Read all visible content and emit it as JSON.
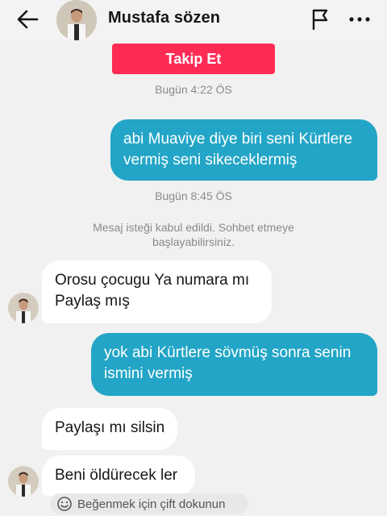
{
  "header": {
    "contact_name": "Mustafa sözen",
    "icons": {
      "back": "arrow-left-icon",
      "flag": "flag-icon",
      "more": "more-horizontal-icon"
    }
  },
  "follow_button": {
    "label": "Takip Et",
    "color": "#fe2c55"
  },
  "timestamps": [
    "Bugün 4:22 ÖS",
    "Bugün 8:45 ÖS"
  ],
  "system_message": {
    "line1": "Mesaj isteği kabul edildi. Sohbet etmeye",
    "line2": "başlayabilirsiniz."
  },
  "messages": [
    {
      "direction": "outgoing",
      "lines": [
        "abi Muaviye diye biri seni Kürtlere",
        "vermiş seni sikeceklermiş"
      ]
    },
    {
      "direction": "incoming",
      "lines": [
        "Orosu çocugu Ya numara mı",
        "Paylaş mış"
      ]
    },
    {
      "direction": "outgoing",
      "lines": [
        "yok abi Kürtlere sövmüş sonra senin",
        "ismini vermiş"
      ]
    },
    {
      "direction": "incoming",
      "lines": [
        "Paylaşı mı silsin"
      ]
    },
    {
      "direction": "incoming",
      "lines": [
        "Beni öldürecek ler"
      ]
    }
  ],
  "like_hint": {
    "text": "Beğenmek için çift dokunun",
    "icon": "smiley-icon"
  },
  "colors": {
    "outgoing_bubble": "#22a5c6",
    "incoming_bubble": "#ffffff",
    "background": "#f1f1f1"
  }
}
